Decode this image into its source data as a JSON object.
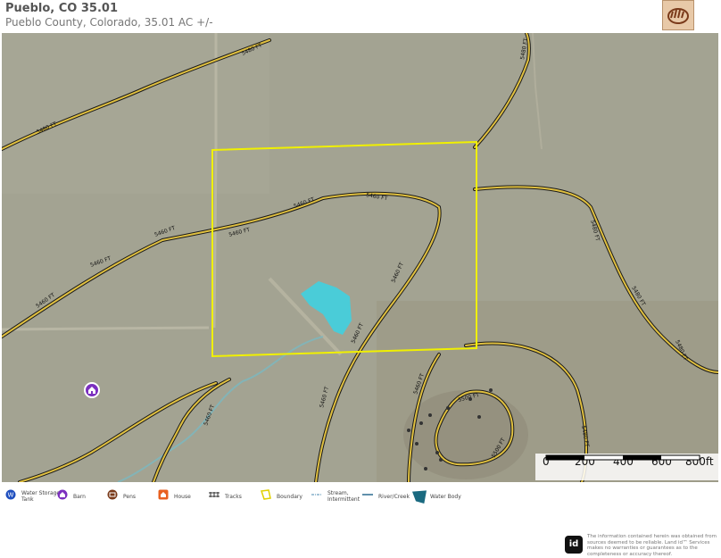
{
  "header": {
    "title": "Pueblo, CO 35.01",
    "subtitle": "Pueblo County, Colorado, 35.01 AC +/-"
  },
  "map": {
    "contour_labels": [
      "5480 FT",
      "5480 FT",
      "5460 FT",
      "5460 FT",
      "5460 FT",
      "5460 FT",
      "5460 FT",
      "5460 FT",
      "5460 FT",
      "5460 FT",
      "5460 FT",
      "5480 FT",
      "5480 FT",
      "5480 FT",
      "5480 FT",
      "5460 FT",
      "5460 FT",
      "5480 FT",
      "5500 FT",
      "5500 FT"
    ],
    "colors": {
      "contour": "#1a1a1a",
      "contour_fill": "#e0c040",
      "boundary": "#f0f000",
      "water_body": "#40d0e0",
      "stream": "#7ab8c0"
    }
  },
  "scalebar": {
    "labels": [
      "0",
      "200",
      "400",
      "600",
      "800ft"
    ]
  },
  "legend": {
    "items": [
      {
        "label": "Water Storage Tank",
        "icon": "water-tank-icon",
        "color": "#1f4fbf"
      },
      {
        "label": "Barn",
        "icon": "barn-icon",
        "color": "#7b2fbf"
      },
      {
        "label": "Pens",
        "icon": "pens-icon",
        "color": "#7a3a1a"
      },
      {
        "label": "House",
        "icon": "house-icon",
        "color": "#e86020"
      },
      {
        "label": "Tracks",
        "icon": "tracks-icon",
        "color": "#333333"
      },
      {
        "label": "Boundary",
        "icon": "boundary-icon",
        "color": "#f0f000"
      },
      {
        "label": "Stream, Intermittent",
        "icon": "stream-icon",
        "color": "#4a8ab0"
      },
      {
        "label": "River/Creek",
        "icon": "river-icon",
        "color": "#2a6a90"
      },
      {
        "label": "Water Body",
        "icon": "water-body-icon",
        "color": "#1a6a80"
      }
    ]
  },
  "footer": {
    "logo_text": "id",
    "disclaimer": "The information contained herein was obtained from sources deemed to be reliable. Land id™ Services makes no warranties or guarantees as to the completeness or accuracy thereof."
  }
}
